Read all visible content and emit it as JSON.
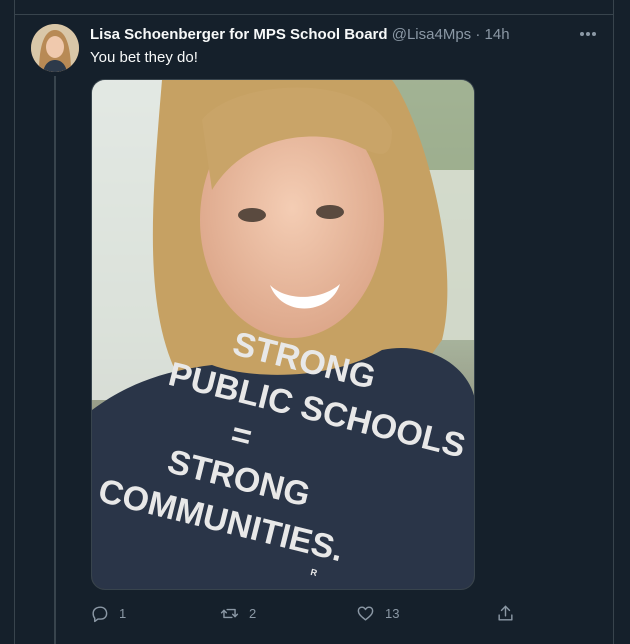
{
  "tweet": {
    "author_name": "Lisa Schoenberger for MPS School Board",
    "handle": "@Lisa4Mps",
    "separator": "·",
    "time": "14h",
    "text": "You bet they do!",
    "shirt_lines": [
      "STRONG",
      "PUBLIC SCHOOLS",
      "=",
      "STRONG",
      "COMMUNITIES."
    ],
    "shirt_mark": "R"
  },
  "actions": {
    "reply_count": "1",
    "retweet_count": "2",
    "like_count": "13"
  },
  "colors": {
    "background": "#15202b",
    "border": "#38444d",
    "secondary_text": "#8b98a5",
    "primary_text": "#f7f9f9"
  },
  "icons": [
    "more-icon",
    "reply-icon",
    "retweet-icon",
    "like-icon",
    "share-icon"
  ]
}
